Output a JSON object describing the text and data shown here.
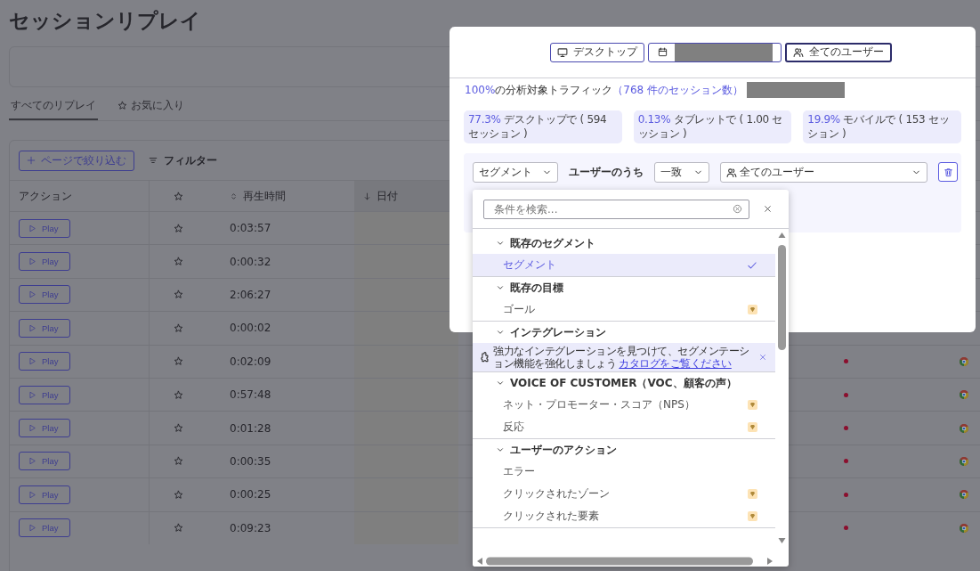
{
  "page": {
    "title": "セッションリプレイ",
    "tabs": [
      {
        "label": "すべてのリプレイ",
        "kind": "plain",
        "selected": true
      },
      {
        "label": "お気に入り",
        "kind": "star",
        "selected": false
      }
    ]
  },
  "table": {
    "filter_button": "ページで絞り込む",
    "filter_link": "フィルター",
    "columns": [
      {
        "kind": "text",
        "label": "アクション"
      },
      {
        "kind": "star"
      },
      {
        "kind": "sortable",
        "label": "再生時間"
      },
      {
        "kind": "sorted_desc",
        "label": "日付"
      }
    ],
    "rows": [
      {
        "action": "Play",
        "duration": "0:03:57"
      },
      {
        "action": "Play",
        "duration": "0:00:32"
      },
      {
        "action": "Play",
        "duration": "2:06:27"
      },
      {
        "action": "Play",
        "duration": "0:00:02"
      },
      {
        "action": "Play",
        "duration": "0:02:09",
        "details_shown": true
      },
      {
        "action": "Play",
        "duration": "0:57:48",
        "details_shown": true
      },
      {
        "action": "Play",
        "duration": "0:01:28",
        "details_shown": true
      },
      {
        "action": "Play",
        "duration": "0:00:35",
        "details_shown": true
      },
      {
        "action": "Play",
        "duration": "0:00:25",
        "details_shown": true
      },
      {
        "action": "Play",
        "duration": "0:09:23",
        "details_shown": true
      }
    ]
  },
  "modal": {
    "device_button": "デスクトップ",
    "users_button": "全てのユーザー",
    "traffic": {
      "share": "100%",
      "text": "の分析対象トラフィック",
      "sessions": "（768 件のセッション数）"
    },
    "stats": [
      {
        "share": "77.3%",
        "text": "デスクトップで ( 594 セッション )"
      },
      {
        "share": "0.13%",
        "text": "タブレットで ( 1.00 セッション )"
      },
      {
        "share": "19.9%",
        "text": "モバイルで ( 153 セッション )"
      }
    ],
    "segment": {
      "type": "セグメント",
      "label": "ユーザーのうち",
      "match": "一致",
      "audience": "全てのユーザー"
    }
  },
  "dropdown": {
    "search_placeholder": "条件を検索...",
    "groups": [
      {
        "label": "既存のセグメント",
        "expanded": true,
        "items": [
          {
            "label": "セグメント",
            "selected": true,
            "premium": false
          }
        ]
      },
      {
        "label": "既存の目標",
        "expanded": true,
        "items": [
          {
            "label": "ゴール",
            "selected": false,
            "premium": true
          }
        ]
      },
      {
        "label": "インテグレーション",
        "expanded": true,
        "banner": {
          "text": "強力なインテグレーションを見つけて、セグメンテーション機能を強化しましょう",
          "link": "カタログをご覧ください"
        }
      },
      {
        "label": "VOICE OF CUSTOMER（VOC、顧客の声）",
        "expanded": true,
        "items": [
          {
            "label": "ネット・プロモーター・スコア（NPS）",
            "selected": false,
            "premium": true
          },
          {
            "label": "反応",
            "selected": false,
            "premium": true
          }
        ]
      },
      {
        "label": "ユーザーのアクション",
        "expanded": true,
        "items": [
          {
            "label": "エラー",
            "selected": false,
            "premium": false
          },
          {
            "label": "クリックされたゾーン",
            "selected": false,
            "premium": true
          },
          {
            "label": "クリックされた要素",
            "selected": false,
            "premium": true
          }
        ]
      }
    ]
  }
}
